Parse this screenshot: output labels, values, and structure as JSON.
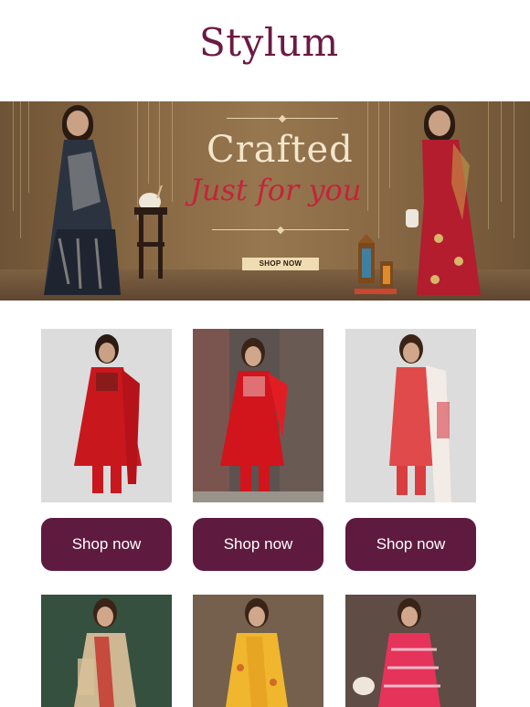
{
  "brand": {
    "logo_text": "Stylum"
  },
  "hero": {
    "title": "Crafted",
    "subtitle": "Just for you",
    "cta_label": "SHOP NOW"
  },
  "products": [
    {
      "image": "red-anarkali-kurta-set",
      "cta_label": "Shop now"
    },
    {
      "image": "red-embroidered-kurta-set",
      "cta_label": "Shop now"
    },
    {
      "image": "coral-kurta-with-dupatta",
      "cta_label": "Shop now"
    },
    {
      "image": "beige-printed-saree"
    },
    {
      "image": "yellow-printed-saree"
    },
    {
      "image": "pink-striped-saree"
    }
  ],
  "colors": {
    "brand_plum": "#5f1a3f",
    "logo_plum": "#6b1a44",
    "banner_gold": "#efdcb2",
    "accent_red": "#c4243b"
  }
}
